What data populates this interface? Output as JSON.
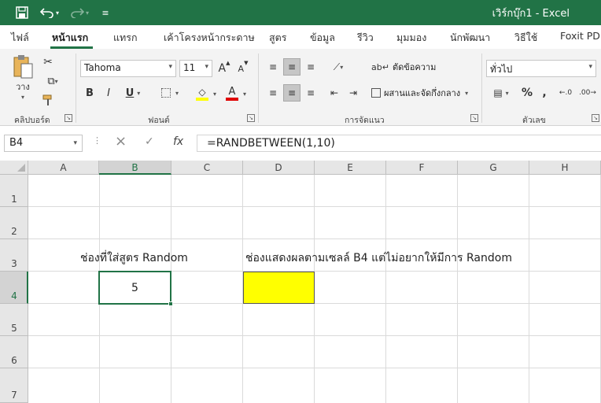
{
  "titlebar": {
    "title": "เวิร์กบุ๊ก1  -  Excel",
    "save_icon": "save-icon",
    "undo_icon": "undo-icon",
    "redo_icon": "redo-icon",
    "customize_icon": "customize-quick-access-icon"
  },
  "tabs": [
    "ไฟล์",
    "หน้าแรก",
    "แทรก",
    "เค้าโครงหน้ากระดาษ",
    "สูตร",
    "ข้อมูล",
    "รีวิว",
    "มุมมอง",
    "นักพัฒนา",
    "วิธีใช้",
    "Foxit PDF"
  ],
  "active_tab": "หน้าแรก",
  "ribbon": {
    "clipboard": {
      "label": "คลิปบอร์ด",
      "paste_label": "วาง"
    },
    "font": {
      "label": "ฟอนต์",
      "font_name": "Tahoma",
      "font_size": "11",
      "bold": "B",
      "italic": "I",
      "underline": "U",
      "grow": "A",
      "shrink": "A"
    },
    "alignment": {
      "label": "การจัดแนว",
      "wrap_text": "ตัดข้อความ",
      "merge_center": "ผสานและจัดกึ่งกลาง"
    },
    "number": {
      "label": "ตัวเลข",
      "format": "ทั่วไป",
      "percent": "%",
      "comma": ","
    }
  },
  "formula_bar": {
    "name_box": "B4",
    "cancel_icon": "×",
    "enter_icon": "✓",
    "fx": "fx",
    "formula": "=RANDBETWEEN(1,10)"
  },
  "sheet": {
    "columns": [
      "A",
      "B",
      "C",
      "D",
      "E",
      "F",
      "G",
      "H"
    ],
    "selected_column": "B",
    "rows": [
      "1",
      "2",
      "3",
      "4",
      "5",
      "6",
      "7"
    ],
    "selected_row": "4",
    "cells": {
      "B3": "ช่องที่ใส่สูตร Random",
      "D3": "ช่องแสดงผลตามเซลล์ B4 แต่ไม่อยากให้มีการ Random",
      "B4": "5"
    },
    "highlight_color": "#ffff00",
    "accent_color": "#217346"
  }
}
